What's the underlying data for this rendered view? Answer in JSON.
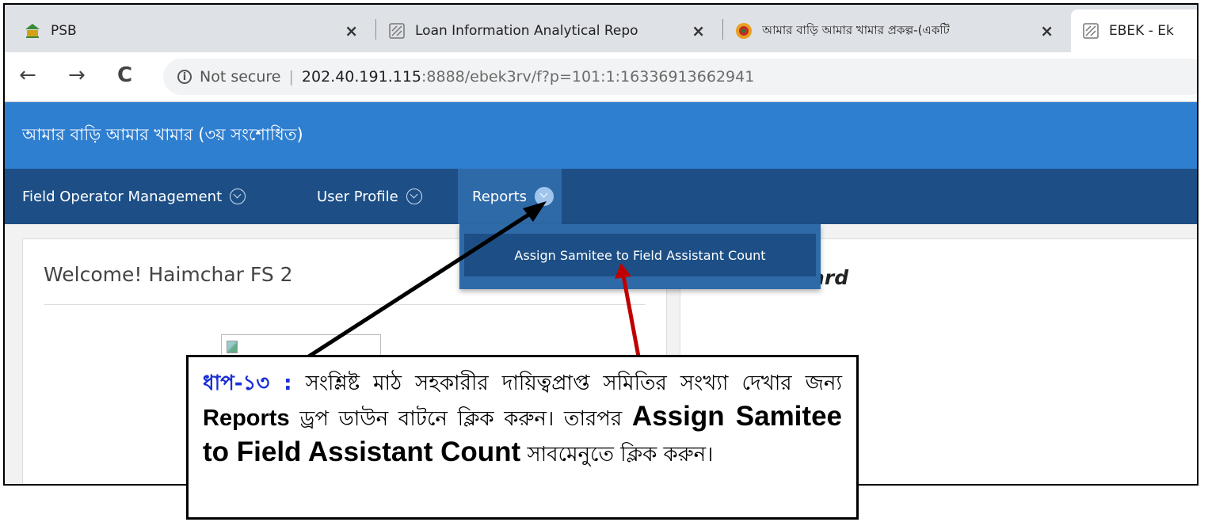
{
  "browser": {
    "tabs": [
      {
        "title": "PSB",
        "close": "×"
      },
      {
        "title": "Loan Information Analytical Repo",
        "close": "×"
      },
      {
        "title": "আমার বাড়ি আমার খামার প্রকল্প-(একটি",
        "close": "×"
      },
      {
        "title": "EBEK - Ek"
      }
    ],
    "nav": {
      "back": "←",
      "forward": "→",
      "reload": "C"
    },
    "address": {
      "info": "i",
      "not_secure": "Not secure",
      "sep": "|",
      "host": "202.40.191.115",
      "rest": ":8888/ebek3rv/f?p=101:1:16336913662941"
    }
  },
  "app": {
    "title": "আমার বাড়ি আমার খামার (৩য় সংশোধিত)",
    "menu": [
      {
        "label": "Field Operator Management"
      },
      {
        "label": "User Profile"
      },
      {
        "label": "Reports"
      }
    ],
    "dropdown_item": "Assign Samitee to Field Assistant Count",
    "welcome": "Welcome! Haimchar FS 2",
    "dashboard_partial": "ard"
  },
  "annotation": {
    "step": "ধাপ-১৩ :",
    "t1": " সংশ্লিষ্ট মাঠ সহকারীর দায়িত্বপ্রাপ্ত সমিতির সংখ্যা দেখার জন্য ",
    "b1": "Reports",
    "t2": " ড্রপ ডাউন বাটনে ক্লিক করুন। তারপর ",
    "b2": "Assign Samitee to Field Assistant Count",
    "t3": " সাবমেনুতে ক্লিক করুন।"
  },
  "colors": {
    "header": "#2f7fd1",
    "menubar": "#1d4f86",
    "step": "#1a2fd6",
    "arrow_red": "#c00000"
  }
}
